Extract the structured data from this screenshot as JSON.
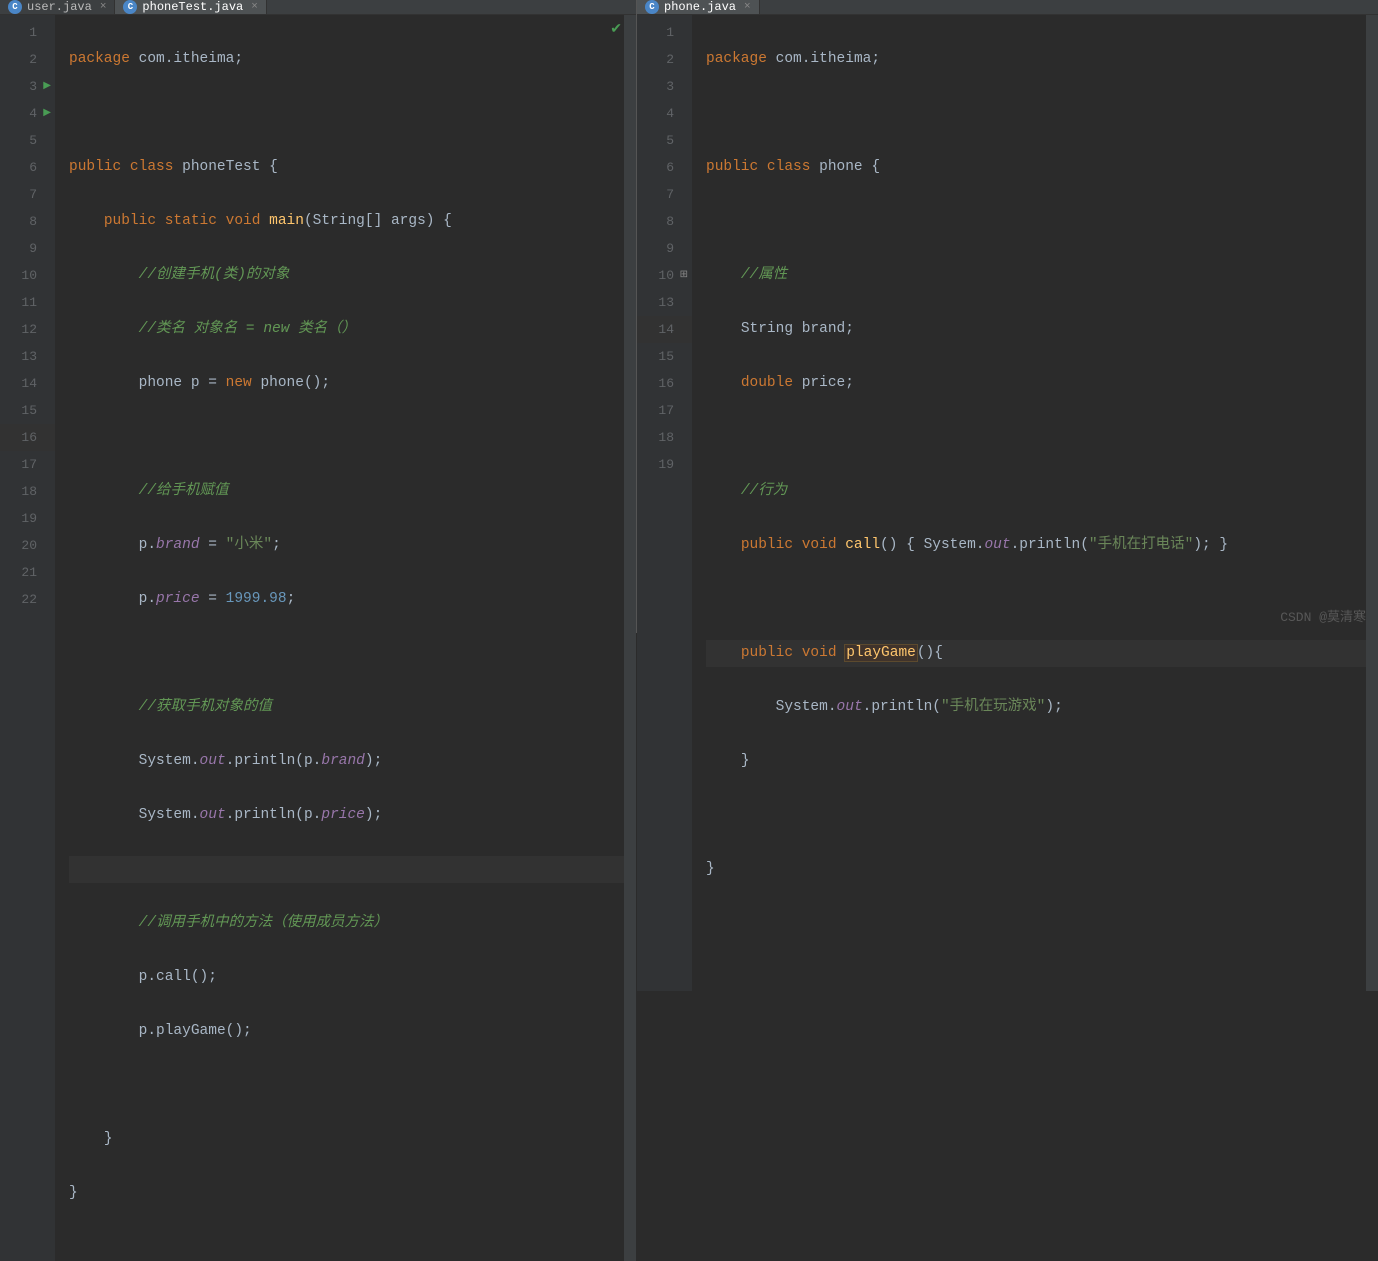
{
  "left": {
    "tabs": [
      {
        "label": "user.java",
        "active": false
      },
      {
        "label": "phoneTest.java",
        "active": true
      }
    ],
    "lineNumbers": [
      "1",
      "2",
      "3",
      "4",
      "5",
      "6",
      "7",
      "8",
      "9",
      "10",
      "11",
      "12",
      "13",
      "14",
      "15",
      "16",
      "17",
      "18",
      "19",
      "20",
      "21",
      "22"
    ],
    "code": {
      "l1_pkg": "package ",
      "l1_name": "com.itheima",
      "l1_semi": ";",
      "l3_pub": "public class ",
      "l3_cls": "phoneTest ",
      "l3_brace": "{",
      "l4_mod": "public static void ",
      "l4_main": "main",
      "l4_sig": "(String[] args) {",
      "l5_cmt": "//创建手机(类)的对象",
      "l6_cmt": "//类名 对象名 = new 类名（）",
      "l7_type": "phone p = ",
      "l7_new": "new ",
      "l7_ctor": "phone();",
      "l9_cmt": "//给手机赋值",
      "l10_p": "p.",
      "l10_brand": "brand",
      "l10_eq": " = ",
      "l10_str": "\"小米\"",
      "l10_semi": ";",
      "l11_p": "p.",
      "l11_price": "price",
      "l11_eq": " = ",
      "l11_num": "1999.98",
      "l11_semi": ";",
      "l13_cmt": "//获取手机对象的值",
      "l14_sys": "System.",
      "l14_out": "out",
      "l14_print": ".println(p.",
      "l14_field": "brand",
      "l14_end": ");",
      "l15_sys": "System.",
      "l15_out": "out",
      "l15_print": ".println(p.",
      "l15_field": "price",
      "l15_end": ");",
      "l17_cmt": "//调用手机中的方法（使用成员方法）",
      "l18": "p.call();",
      "l19": "p.playGame();",
      "l21": "}",
      "l22": "}"
    }
  },
  "right": {
    "tabs": [
      {
        "label": "phone.java",
        "active": true
      }
    ],
    "lineNumbers": [
      "1",
      "2",
      "3",
      "4",
      "5",
      "6",
      "7",
      "8",
      "9",
      "10",
      "13",
      "14",
      "15",
      "16",
      "17",
      "18",
      "19"
    ],
    "code": {
      "l1_pkg": "package ",
      "l1_name": "com.itheima",
      "l1_semi": ";",
      "l3_pub": "public class ",
      "l3_cls": "phone ",
      "l3_brace": "{",
      "l5_cmt": "//属性",
      "l6_type": "String ",
      "l6_name": "brand;",
      "l7_type": "double ",
      "l7_name": "price;",
      "l9_cmt": "//行为",
      "l10_mod": "public void ",
      "l10_name": "call",
      "l10_sig": "() { ",
      "l10_sys": "System.",
      "l10_out": "out",
      "l10_print": ".println(",
      "l10_str": "\"手机在打电话\"",
      "l10_end": "); }",
      "l14_mod": "public void ",
      "l14_name": "playGame",
      "l14_sig": "(){",
      "l15_sys": "System.",
      "l15_out": "out",
      "l15_print": ".println(",
      "l15_str": "\"手机在玩游戏\"",
      "l15_end": ");",
      "l16": "}",
      "l18": "}"
    }
  },
  "watermark": "CSDN @莫清寒"
}
